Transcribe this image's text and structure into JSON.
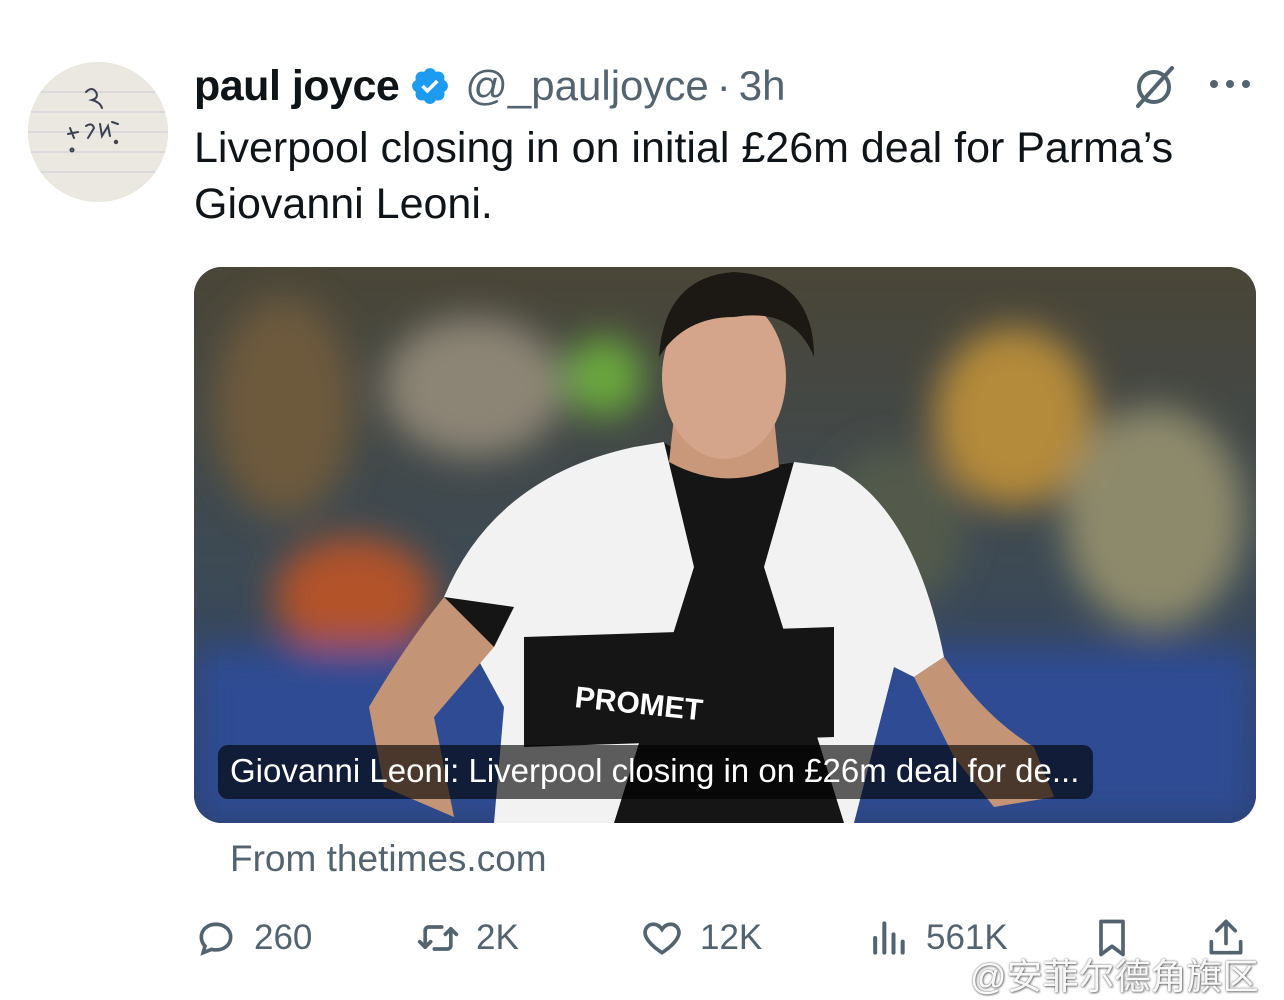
{
  "author": {
    "name": "paul joyce",
    "handle": "@_pauljoyce",
    "separator": "·",
    "time": "3h",
    "verified": true,
    "avatar": "handwritten-note-avatar"
  },
  "tweet": {
    "text": "Liverpool closing in on initial £26m deal for Parma’s Giovanni Leoni."
  },
  "card": {
    "caption": "Giovanni Leoni: Liverpool closing in on £26m deal for de...",
    "source": "From thetimes.com"
  },
  "actions": {
    "replies": "260",
    "reposts": "2K",
    "likes": "12K",
    "views": "561K"
  },
  "icons": {
    "grok": "grok-icon",
    "more": "more-icon",
    "reply": "reply-icon",
    "repost": "repost-icon",
    "like": "heart-icon",
    "views": "views-icon",
    "bookmark": "bookmark-icon",
    "share": "share-icon"
  },
  "colors": {
    "text": "#0f1419",
    "secondary": "#536471",
    "verified": "#1d9bf0"
  },
  "watermark": "@安菲尔德角旗区"
}
